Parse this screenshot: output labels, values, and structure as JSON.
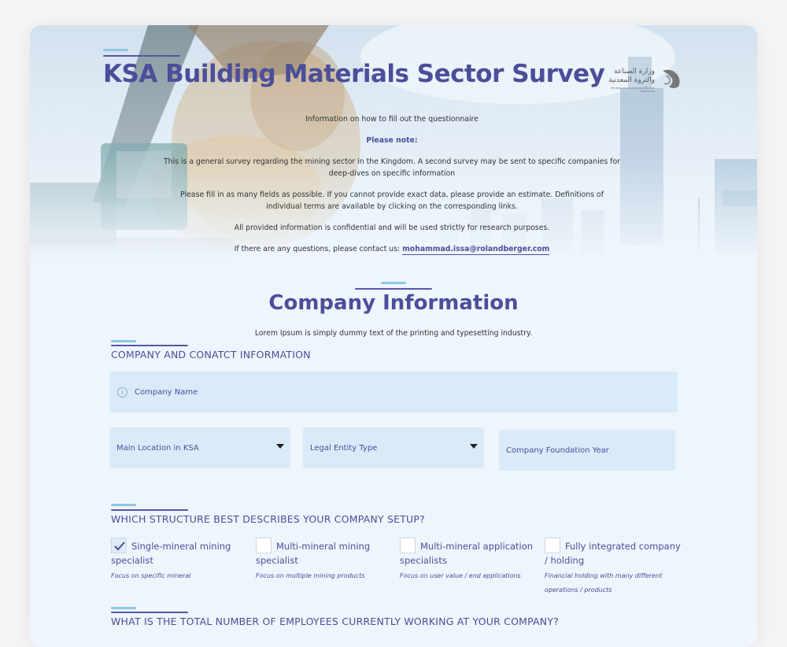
{
  "header": {
    "title": "KSA Building Materials Sector Survey",
    "logo": {
      "arabic_line1": "وزارة الصناعة",
      "arabic_line2": "والثروة المعدنية",
      "english": "Ministry of Industry and Mineral Resources"
    },
    "intro_heading": "Information on how to fill out the questionnaire",
    "note_label": "Please note:",
    "paragraph_1": "This is a general survey regarding the mining sector in the Kingdom. A second survey may be sent to specific companies for deep-dives on specific information",
    "paragraph_2": "Please fill in as many fields as possible. If you cannot provide exact data, please provide an estimate. Definitions of individual terms are available by clicking on the corresponding links.",
    "paragraph_3": "All provided information is confidential and will be used strictly for research purposes.",
    "contact_prefix": "If there are any questions, please contact us:",
    "contact_email": "mohammad.issa@rolandberger.com"
  },
  "section": {
    "title": "Company Information",
    "subtitle": "Lorem Ipsum is simply dummy text of the printing and typesetting industry."
  },
  "contact_group": {
    "heading": "COMPANY AND CONATCT INFORMATION",
    "company_name_placeholder": "Company Name",
    "main_location_label": "Main Location in KSA",
    "legal_entity_label": "Legal Entity Type",
    "foundation_year_placeholder": "Company Foundation Year"
  },
  "structure_group": {
    "heading": "WHICH STRUCTURE BEST DESCRIBES YOUR COMPANY SETUP?",
    "options": [
      {
        "label": "Single-mineral mining specialist",
        "desc": "Focus on specific mineral",
        "checked": true
      },
      {
        "label": "Multi-mineral mining specialist",
        "desc": "Focus on multiple mining products",
        "checked": false
      },
      {
        "label": "Multi-mineral application specialists",
        "desc": "Focus on user value / end applications",
        "checked": false
      },
      {
        "label": "Fully integrated company / holding",
        "desc": "Financial holding with many different operations / products",
        "checked": false
      }
    ]
  },
  "employees_group": {
    "heading": "WHAT IS THE TOTAL NUMBER OF EMPLOYEES CURRENTLY WORKING AT YOUR COMPANY?"
  },
  "colors": {
    "primary": "#4b4e99",
    "accent_light": "#8cc7e6",
    "field_bg": "#d9ebf8",
    "page_bg": "#eef5fc"
  }
}
